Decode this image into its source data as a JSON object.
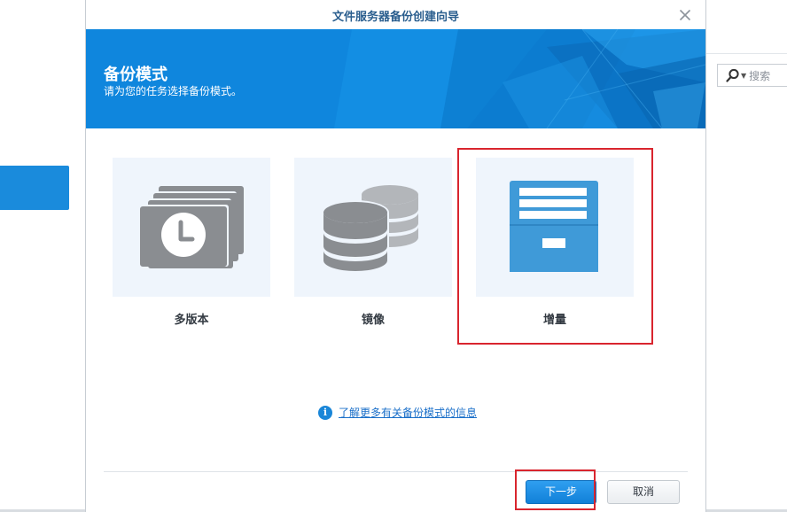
{
  "search": {
    "placeholder": "搜索"
  },
  "dialog": {
    "title": "文件服务器备份创建向导",
    "banner_title": "备份模式",
    "banner_subtitle": "请为您的任务选择备份模式。",
    "options": [
      {
        "label": "多版本",
        "icon": "multi-version-clock-icon",
        "selected": false
      },
      {
        "label": "镜像",
        "icon": "mirror-database-icon",
        "selected": false
      },
      {
        "label": "增量",
        "icon": "incremental-archive-icon",
        "selected": true
      }
    ],
    "info_link": "了解更多有关备份模式的信息",
    "buttons": {
      "next": "下一步",
      "cancel": "取消"
    }
  },
  "colors": {
    "accent": "#1a86d8",
    "banner": "#0f86dd",
    "highlight_border": "#d9252e",
    "card_bg": "#eff5fc",
    "icon_gray": "#8a8d91",
    "icon_blue": "#3f9ad8"
  }
}
